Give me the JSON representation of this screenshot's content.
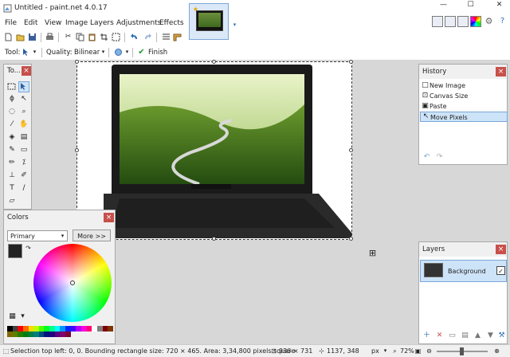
{
  "window": {
    "title": "Untitled - paint.net 4.0.17"
  },
  "menu": [
    "File",
    "Edit",
    "View",
    "Image",
    "Layers",
    "Adjustments",
    "Effects"
  ],
  "toolbar2": {
    "tool_label": "Tool:",
    "quality_label": "Quality:",
    "quality_value": "Bilinear",
    "finish_label": "Finish"
  },
  "tools_panel": {
    "title": "To..."
  },
  "history": {
    "title": "History",
    "items": [
      "New Image",
      "Canvas Size",
      "Paste",
      "Move Pixels"
    ]
  },
  "layers": {
    "title": "Layers",
    "items": [
      "Background"
    ]
  },
  "colors": {
    "title": "Colors",
    "mode": "Primary",
    "more_label": "More >>"
  },
  "status": {
    "selection_text": "Selection top left: 0, 0. Bounding rectangle size: 720 × 465. Area: 3,34,800 pixels square",
    "image_size": "936 × 731",
    "cursor_pos": "1137, 348",
    "unit": "px",
    "zoom": "72%"
  },
  "colors_hex": {
    "accent": "#1e73d8",
    "close": "#c7504b",
    "selected_row": "#cde3f8",
    "canvas_bg": "#d7d7d7"
  },
  "palette": [
    "#000000",
    "#404040",
    "#ff0000",
    "#ff6a00",
    "#ffd800",
    "#b6ff00",
    "#4cff00",
    "#00ff21",
    "#00ff90",
    "#00ffff",
    "#0094ff",
    "#0026ff",
    "#4800ff",
    "#b200ff",
    "#ff00dc",
    "#ff006e",
    "#ffffff",
    "#808080",
    "#7f0000",
    "#7f3300",
    "#7f6a00",
    "#5b7f00",
    "#267f00",
    "#007f0e",
    "#007f46",
    "#007f7f",
    "#004a7f",
    "#00137f",
    "#21007f",
    "#57007f",
    "#7f006e",
    "#7f0037"
  ]
}
